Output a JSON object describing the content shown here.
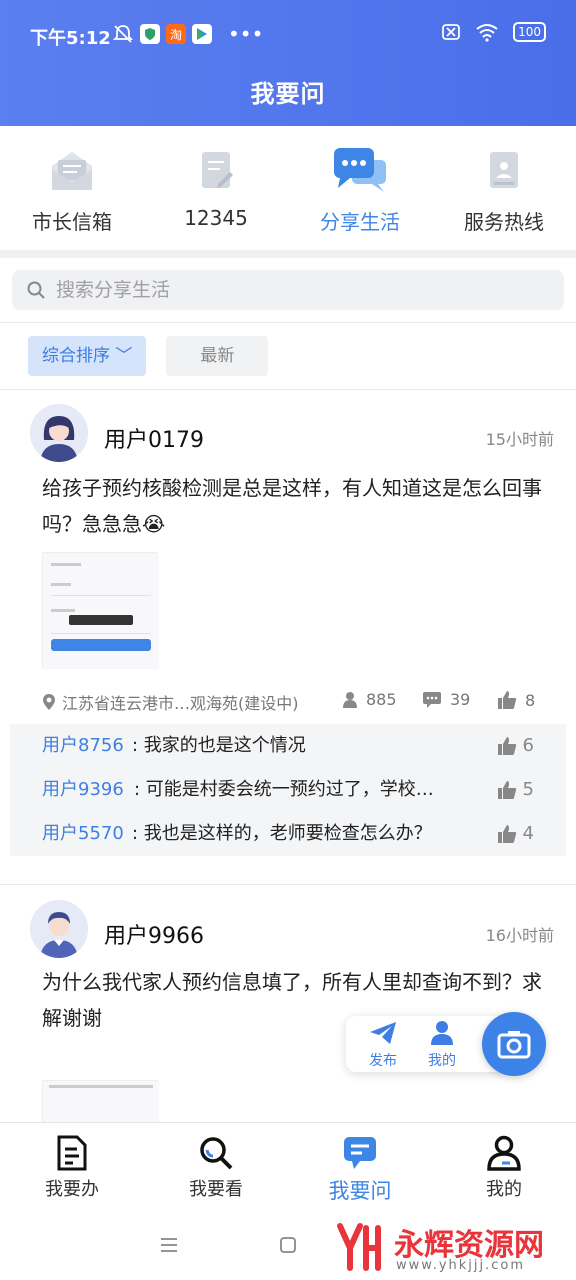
{
  "status_bar": {
    "time": "下午5:12",
    "battery": "100"
  },
  "header": {
    "title": "我要问"
  },
  "tabs": [
    {
      "label": "市长信箱",
      "icon": "mail-icon"
    },
    {
      "label": "12345",
      "icon": "document-edit-icon"
    },
    {
      "label": "分享生活",
      "icon": "chat-bubbles-icon",
      "active": true
    },
    {
      "label": "服务热线",
      "icon": "contact-card-icon"
    }
  ],
  "search": {
    "placeholder": "搜索分享生活"
  },
  "sort": {
    "options": [
      "综合排序",
      "最新"
    ],
    "active": "综合排序"
  },
  "posts": [
    {
      "user": "用户0179",
      "time": "15小时前",
      "text": "给孩子预约核酸检测是总是这样，有人知道这是怎么回事吗？急急急😭",
      "location": "江苏省连云港市…观海苑(建设中)",
      "views": "885",
      "comments_count": "39",
      "likes": "8",
      "comments": [
        {
          "user": "用户8756",
          "text": ": 我家的也是这个情况",
          "likes": "6"
        },
        {
          "user": "用户9396",
          "text": ": 可能是村委会统一预约过了，学校…",
          "likes": "5"
        },
        {
          "user": "用户5570",
          "text": ": 我也是这样的，老师要检查怎么办？",
          "likes": "4"
        }
      ]
    },
    {
      "user": "用户9966",
      "time": "16小时前",
      "text": "为什么我代家人预约信息填了，所有人里却查询不到？求解谢谢"
    }
  ],
  "float_actions": {
    "publish": "发布",
    "mine": "我的"
  },
  "bottom_nav": [
    {
      "label": "我要办",
      "icon": "document-icon"
    },
    {
      "label": "我要看",
      "icon": "search-icon"
    },
    {
      "label": "我要问",
      "icon": "chat-icon",
      "active": true
    },
    {
      "label": "我的",
      "icon": "person-icon"
    }
  ],
  "watermark": {
    "text": "永辉资源网",
    "url": "www.yhkjjj.com",
    "logo": "YH"
  },
  "colors": {
    "accent": "#3e86e6",
    "header": "#5378ee"
  }
}
